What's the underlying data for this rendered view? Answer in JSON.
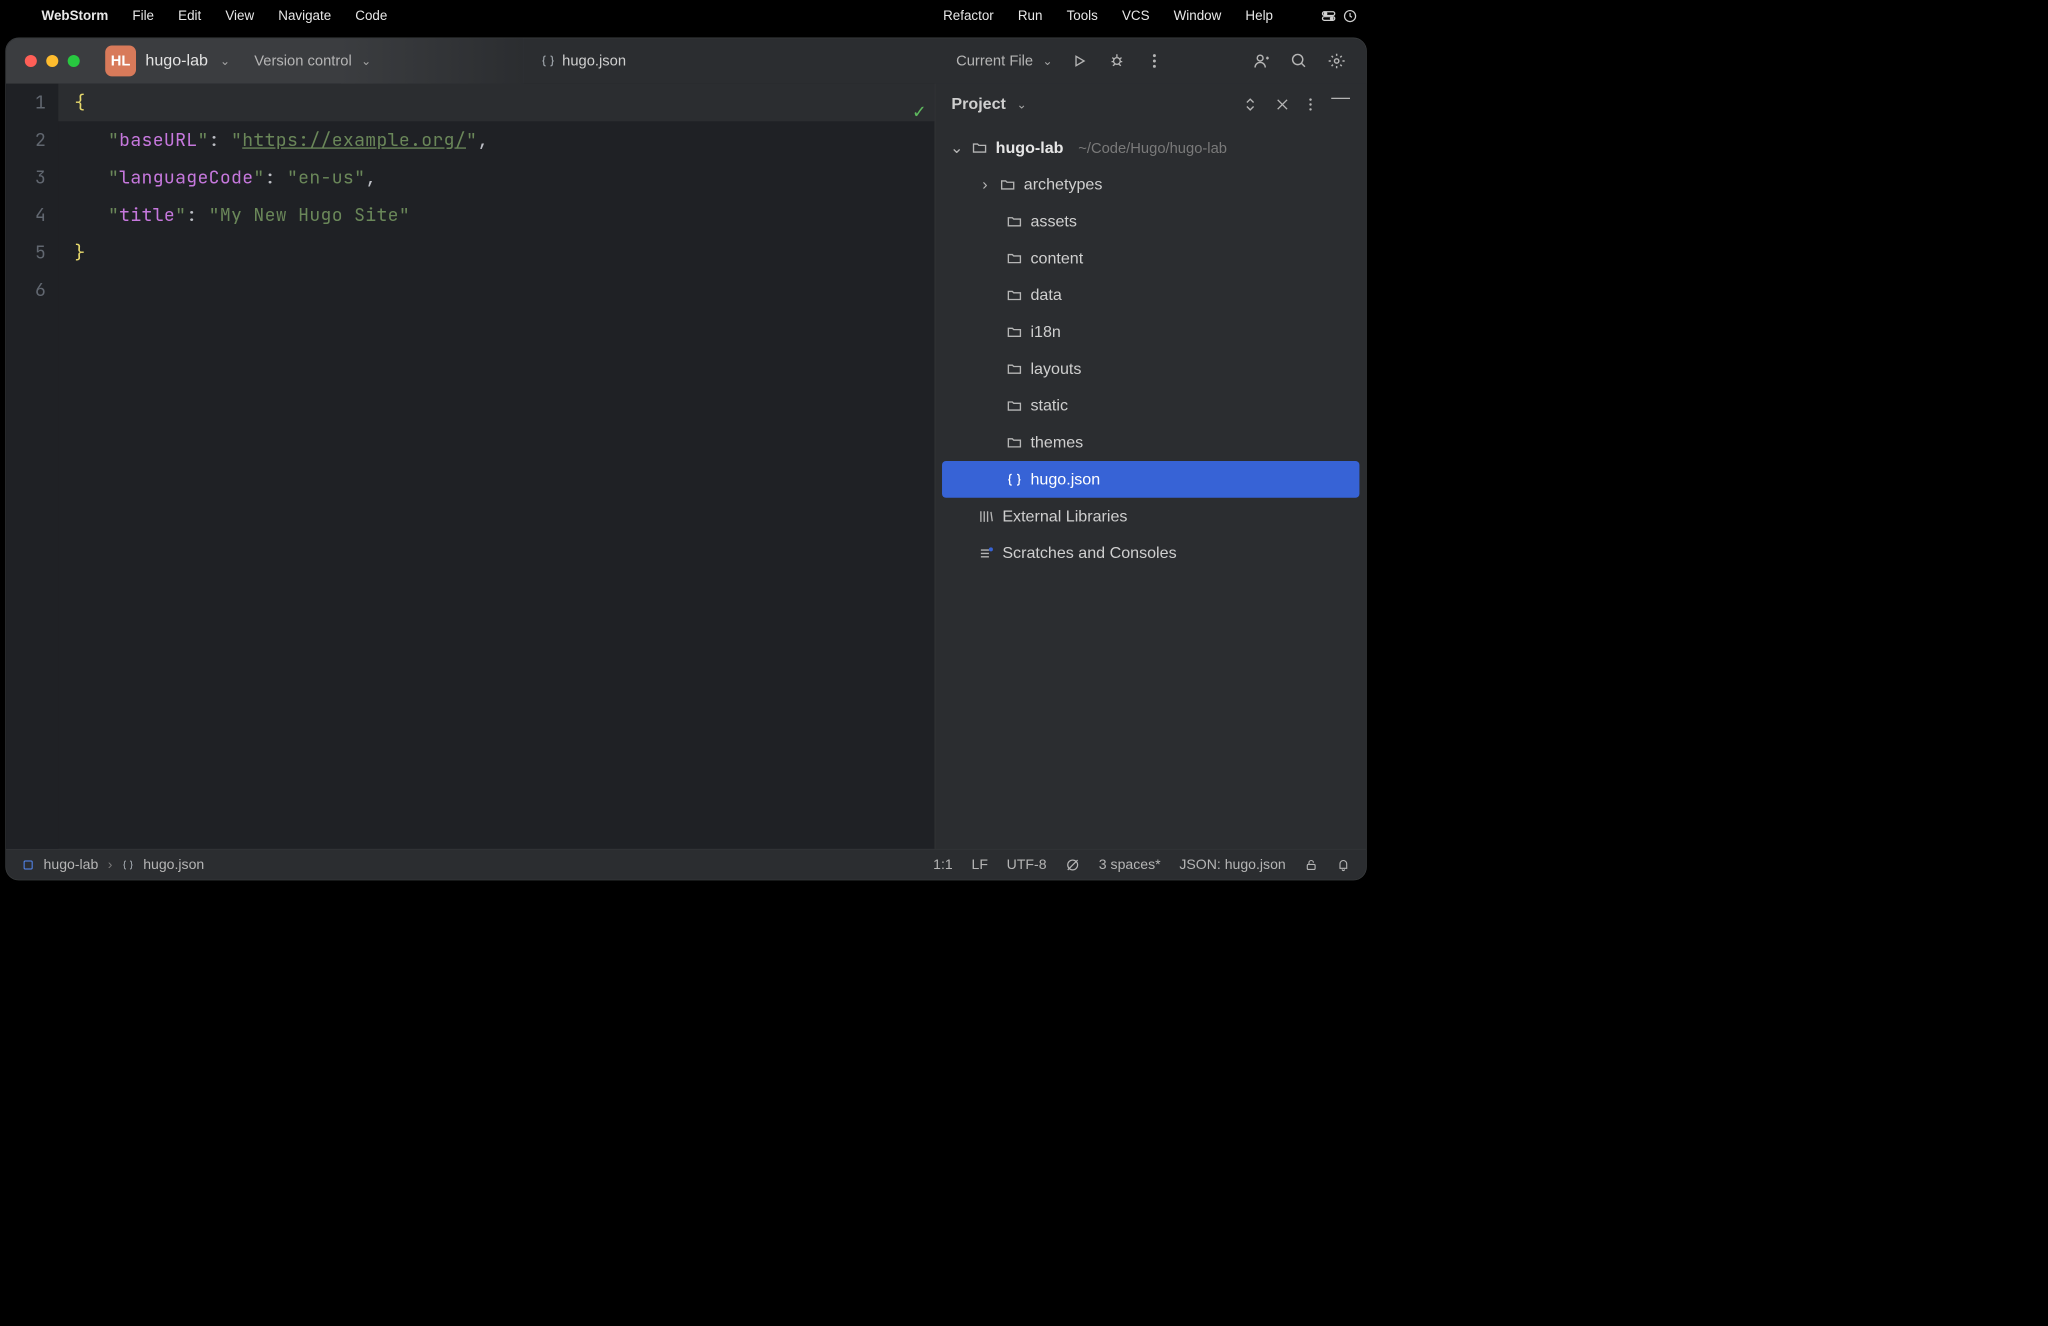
{
  "menubar": {
    "app": "WebStorm",
    "items": [
      "File",
      "Edit",
      "View",
      "Navigate",
      "Code",
      "Refactor",
      "Run",
      "Tools",
      "VCS",
      "Window",
      "Help"
    ]
  },
  "titlebar": {
    "proj_initials": "HL",
    "proj_name": "hugo-lab",
    "vc_label": "Version control",
    "tab_file": "hugo.json",
    "run_label": "Current File"
  },
  "editor": {
    "lines": [
      "1",
      "2",
      "3",
      "4",
      "5",
      "6"
    ],
    "code": {
      "l1": "{",
      "l2_key": "baseURL",
      "l2_val": "https://example.org/",
      "l3_key": "languageCode",
      "l3_val": "en-us",
      "l4_key": "title",
      "l4_val": "My New Hugo Site",
      "l5": "}"
    }
  },
  "tool": {
    "title": "Project",
    "root": "hugo-lab",
    "root_path": "~/Code/Hugo/hugo-lab",
    "children": [
      "archetypes",
      "assets",
      "content",
      "data",
      "i18n",
      "layouts",
      "static",
      "themes"
    ],
    "file": "hugo.json",
    "external": "External Libraries",
    "scratches": "Scratches and Consoles"
  },
  "status": {
    "crumb_root": "hugo-lab",
    "crumb_file": "hugo.json",
    "pos": "1:1",
    "eol": "LF",
    "enc": "UTF-8",
    "indent": "3 spaces*",
    "lang": "JSON: hugo.json"
  }
}
